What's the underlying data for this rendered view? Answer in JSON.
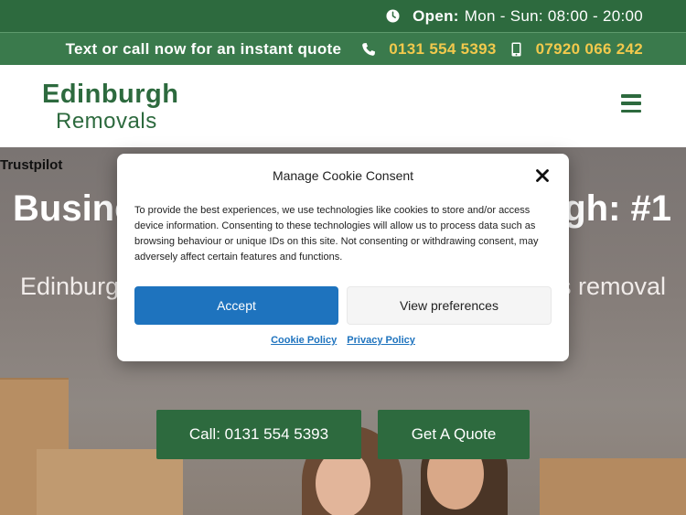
{
  "topbar": {
    "open_label": "Open:",
    "hours": "Mon - Sun: 08:00 - 20:00",
    "quote_text": "Text or call now for an instant quote",
    "phone_landline": "0131 554 5393",
    "phone_mobile": "07920 066 242"
  },
  "header": {
    "logo_line1": "Edinburgh",
    "logo_line2": "Removals",
    "menu_icon": "hamburger-icon"
  },
  "hero": {
    "trustpilot": "Trustpilot",
    "title_left": "Busine",
    "title_right": "rgh: #1",
    "subtitle_left": "Edinburgh",
    "subtitle_right": "s removal",
    "call_button": "Call: 0131 554 5393",
    "quote_button": "Get A Quote"
  },
  "cookie_modal": {
    "title": "Manage Cookie Consent",
    "body": "To provide the best experiences, we use technologies like cookies to store and/or access device information. Consenting to these technologies will allow us to process data such as browsing behaviour or unique IDs on this site. Not consenting or withdrawing consent, may adversely affect certain features and functions.",
    "accept_label": "Accept",
    "prefs_label": "View preferences",
    "cookie_policy": "Cookie Policy",
    "privacy_policy": "Privacy Policy"
  },
  "colors": {
    "brand_green": "#2d6a3e",
    "phone_yellow": "#f2c94c",
    "accept_blue": "#1e73be"
  }
}
